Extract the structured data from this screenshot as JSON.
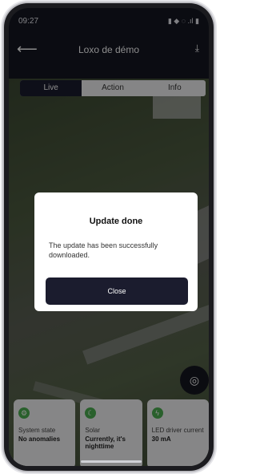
{
  "status_bar": {
    "time": "09:27",
    "icons_right": "▮ ◆ ◌ .ıl ▮"
  },
  "header": {
    "title": "Loxo de démo",
    "back_glyph": "⟵",
    "download_glyph": "⤓"
  },
  "tabs": [
    {
      "label": "Live",
      "active": true
    },
    {
      "label": "Action",
      "active": false
    },
    {
      "label": "Info",
      "active": false
    }
  ],
  "cards": [
    {
      "icon": "gear-icon",
      "label": "System state",
      "value": "No anomalies"
    },
    {
      "icon": "moon-icon",
      "label": "Solar",
      "value": "Currently, it's nighttime"
    },
    {
      "icon": "bolt-icon",
      "label": "LED driver current",
      "value": "30 mA"
    }
  ],
  "fab": {
    "icon": "headset-icon"
  },
  "dialog": {
    "title": "Update done",
    "message": "The update has been successfully downloaded.",
    "button": "Close"
  },
  "colors": {
    "dark_navy": "#1b1c2e",
    "green": "#4caf50"
  }
}
